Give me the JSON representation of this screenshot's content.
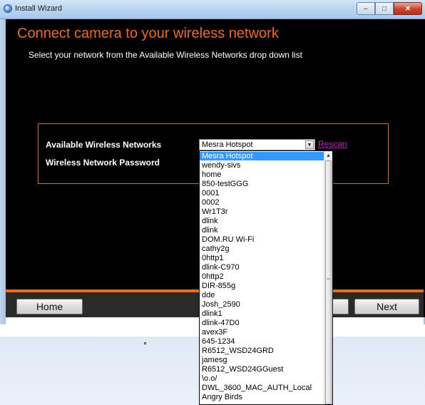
{
  "window": {
    "title": "Install Wizard",
    "controls": {
      "minimize": "–",
      "maximize": "□",
      "close": "✕"
    }
  },
  "page": {
    "heading": "Connect camera to your wireless network",
    "subheading": "Select your network from the Available Wireless Networks drop down list"
  },
  "form": {
    "networks_label": "Available Wireless Networks",
    "password_label": "Wireless Network Password",
    "selected_network": "Mesra Hotspot",
    "rescan_label": "Rescan",
    "networks": [
      "Mesra Hotspot",
      "wendy-sivs",
      "home",
      "850-testGGG",
      "0001",
      "0002",
      "Wr1T3r",
      "dlink",
      "dlink",
      "DOM.RU Wi-Fi",
      "cathy2g",
      "0http1",
      "dlink-C970",
      "0http2",
      "DIR-855g",
      "dde",
      "Josh_2590",
      "dlink1",
      "dlink-47D0",
      "avex3F",
      "645-1234",
      "R6512_WSD24GRD",
      "jamesg",
      "R6512_WSD24GGuest",
      "\\o.o/",
      "DWL_3600_MAC_AUTH_Local",
      "Angry Birds"
    ]
  },
  "footer": {
    "home_label": "Home",
    "next_label": "Next"
  },
  "colors": {
    "accent_orange": "#f06a1a",
    "background": "#000000",
    "rescan_link": "#c020c0",
    "selection": "#3399ff"
  },
  "icons": {
    "title_icon": "install-wizard-icon",
    "dropdown_arrow": "chevron-down-icon",
    "scroll_up": "scroll-up-arrow-icon"
  }
}
